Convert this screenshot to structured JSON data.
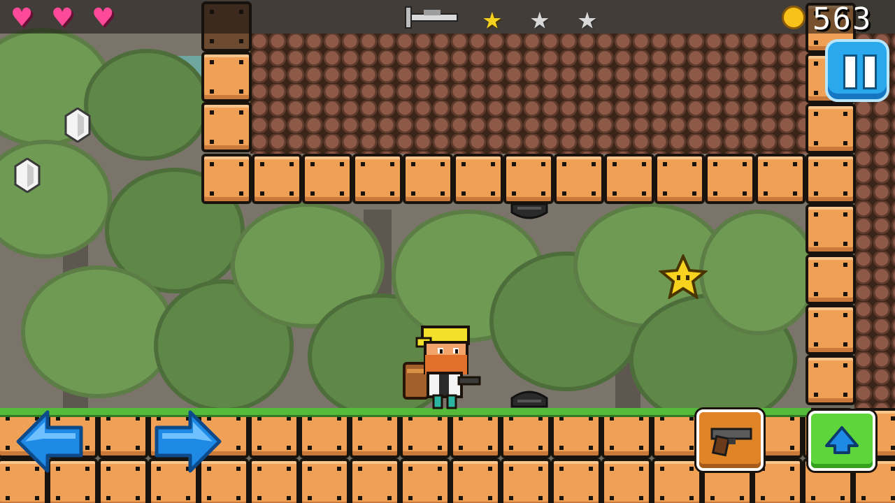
{
  "hud": {
    "hearts": [
      {
        "icon": "heart-icon",
        "state": "full"
      },
      {
        "icon": "heart-icon",
        "state": "full"
      },
      {
        "icon": "heart-icon",
        "state": "full"
      }
    ],
    "weapon_icon": "weapon-silhouette-icon",
    "stars": [
      {
        "icon": "star-icon",
        "state": "collected",
        "color": "#f5d21e"
      },
      {
        "icon": "star-icon",
        "state": "empty",
        "color": "#d8d8d8"
      },
      {
        "icon": "star-icon",
        "state": "empty",
        "color": "#d8d8d8"
      }
    ],
    "coin_icon": "coin-icon",
    "coin_count": "563",
    "pause_icon": "pause-icon"
  },
  "controls": {
    "left_icon": "left-arrow-icon",
    "right_icon": "right-arrow-icon",
    "fire_icon": "pistol-icon",
    "jump_icon": "up-arrow-icon"
  },
  "colors": {
    "block": "#f0a155",
    "grass": "#55b93a",
    "heart": "#ff4a9a",
    "pause": "#2aa8ee",
    "jump": "#5ed53a",
    "fire": "#e08428",
    "move": "#1e8ae6"
  }
}
